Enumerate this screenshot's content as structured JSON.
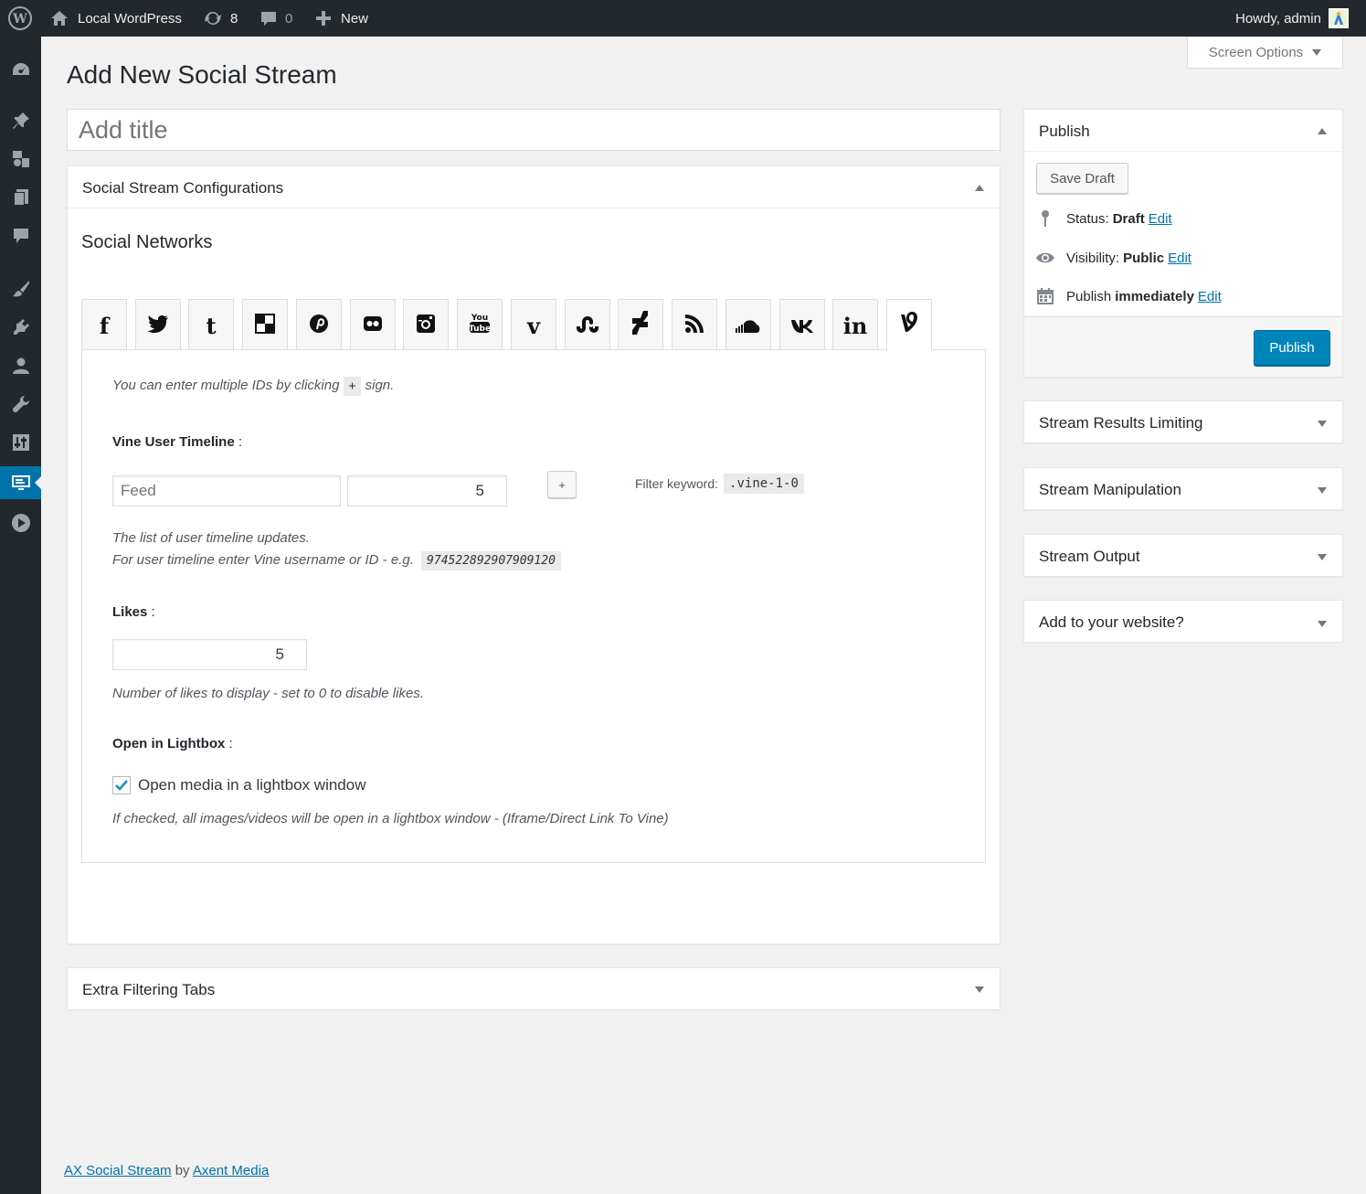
{
  "adminbar": {
    "site_name": "Local WordPress",
    "updates_count": "8",
    "comments_count": "0",
    "new_label": "New",
    "greeting": "Howdy, admin"
  },
  "screen_options": {
    "label": "Screen Options"
  },
  "page": {
    "title": "Add New Social Stream"
  },
  "title_field": {
    "placeholder": "Add title",
    "value": ""
  },
  "config_box": {
    "title": "Social Stream Configurations",
    "section_heading": "Social Networks",
    "networks": [
      {
        "name": "facebook",
        "glyph": "f"
      },
      {
        "name": "twitter",
        "glyph": ""
      },
      {
        "name": "tumblr",
        "glyph": "t"
      },
      {
        "name": "delicious",
        "glyph": ""
      },
      {
        "name": "pinterest",
        "glyph": ""
      },
      {
        "name": "flickr",
        "glyph": ""
      },
      {
        "name": "instagram",
        "glyph": ""
      },
      {
        "name": "youtube",
        "glyph": ""
      },
      {
        "name": "vimeo",
        "glyph": "v"
      },
      {
        "name": "stumbleupon",
        "glyph": ""
      },
      {
        "name": "deviantart",
        "glyph": ""
      },
      {
        "name": "rss",
        "glyph": ""
      },
      {
        "name": "soundcloud",
        "glyph": ""
      },
      {
        "name": "vk",
        "glyph": ""
      },
      {
        "name": "linkedin",
        "glyph": "in"
      },
      {
        "name": "vine",
        "glyph": ""
      }
    ],
    "multiple_ids_hint_before": "You can enter multiple IDs by clicking",
    "multiple_ids_sign": "+",
    "multiple_ids_hint_after": "sign.",
    "vine_timeline": {
      "label": "Vine User Timeline",
      "feed_placeholder": "Feed",
      "count_value": "5",
      "add_button": "+",
      "filter_label": "Filter keyword:",
      "filter_code": ".vine-1-0",
      "help_line1": "The list of user timeline updates.",
      "help_line2": "For user timeline enter Vine username or ID - e.g.",
      "help_code": "974522892907909120"
    },
    "likes": {
      "label": "Likes",
      "value": "5",
      "help": "Number of likes to display - set to 0 to disable likes."
    },
    "lightbox": {
      "label": "Open in Lightbox",
      "checkbox_label": "Open media in a lightbox window",
      "checked": true,
      "help": "If checked, all images/videos will be open in a lightbox window - (Iframe/Direct Link To Vine)"
    }
  },
  "extra_box": {
    "title": "Extra Filtering Tabs"
  },
  "publish_box": {
    "title": "Publish",
    "save_draft": "Save Draft",
    "status_label": "Status:",
    "status_value": "Draft",
    "visibility_label": "Visibility:",
    "visibility_value": "Public",
    "publish_label": "Publish",
    "publish_value": "immediately",
    "edit_link": "Edit",
    "publish_button": "Publish"
  },
  "side_boxes": [
    {
      "title": "Stream Results Limiting"
    },
    {
      "title": "Stream Manipulation"
    },
    {
      "title": "Stream Output"
    },
    {
      "title": "Add to your website?"
    }
  ],
  "footer": {
    "plugin_link": "AX Social Stream",
    "by": "by",
    "author_link": "Axent Media"
  },
  "colors": {
    "primary": "#0085ba",
    "link": "#0073aa",
    "adminbar": "#23282d"
  }
}
